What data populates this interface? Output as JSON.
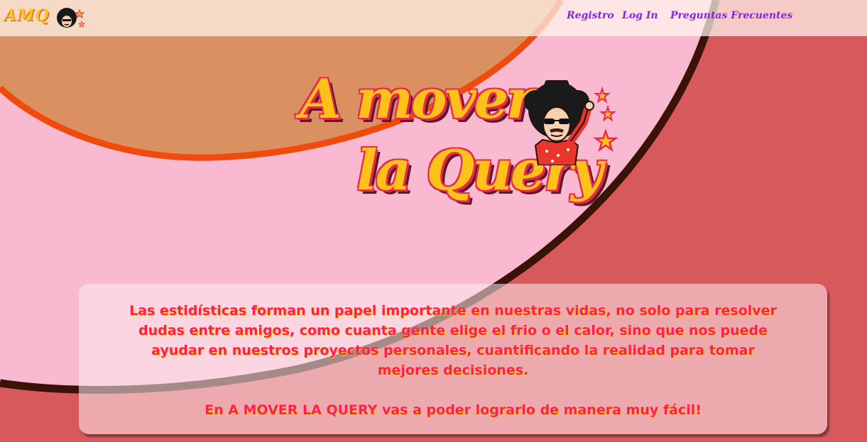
{
  "nav": {
    "brand_text": "AMQ",
    "links": [
      "Registro",
      "Log In",
      "Preguntas Frecuentes"
    ]
  },
  "hero": {
    "logo_line1": "A mover",
    "logo_line2": "la Query"
  },
  "info": {
    "text": "Las estidísticas forman un papel importante en nuestras vidas, no solo para resolver dudas entre amigos, como cuanta gente elige el frio o el calor, sino que nos puede ayudar en nuestros proyectos personales, cuantificando la realidad para tomar mejores decisiones.",
    "cta": "En A MOVER LA QUERY vas a poder lograrlo de manera muy fácil!"
  },
  "colors": {
    "background_red": "#d8595b",
    "pink_wave": "#f9b9d1",
    "orange_wave": "#db9061",
    "orange_line": "#f04a0c",
    "dark_line": "#3b1208",
    "logo_yellow": "#ffc21a",
    "logo_pink": "#e8294e",
    "nav_link": "#8a22e0",
    "body_text": "#ff1f57"
  },
  "icons": [
    "afro-mascot-icon",
    "star-icon"
  ]
}
